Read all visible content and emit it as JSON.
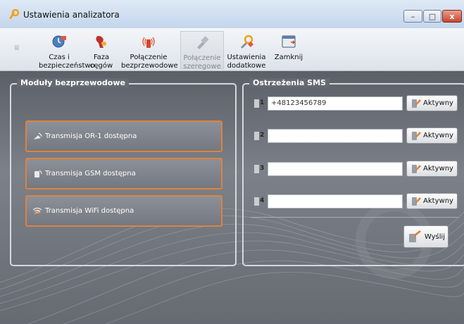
{
  "window": {
    "title": "Ustawienia analizatora",
    "minimize": "–",
    "maximize": "□",
    "close": "x"
  },
  "toolbar": {
    "items": [
      {
        "label1": "Czas i",
        "label2": "bezpieczeństwo",
        "icon": "clock-security-icon"
      },
      {
        "label1": "Faza",
        "label2": "cęgów",
        "icon": "clamp-phase-icon"
      },
      {
        "label1": "Połączenie",
        "label2": "bezprzewodowe",
        "icon": "wireless-connection-icon"
      },
      {
        "label1": "Połączenie",
        "label2": "szeregowe",
        "icon": "serial-connection-icon"
      },
      {
        "label1": "Ustawienia",
        "label2": "dodatkowe",
        "icon": "additional-settings-icon"
      },
      {
        "label1": "Zamknij",
        "label2": "",
        "icon": "close-window-icon"
      }
    ]
  },
  "wireless": {
    "title": "Moduły bezprzewodowe",
    "items": [
      {
        "label": "Transmisja OR-1 dostępna"
      },
      {
        "label": "Transmisja GSM dostępna"
      },
      {
        "label": "Transmisja WiFi dostępna"
      }
    ]
  },
  "sms": {
    "title": "Ostrzeżenia SMS",
    "rows": [
      {
        "index": "1",
        "value": "+48123456789",
        "button": "Aktywny"
      },
      {
        "index": "2",
        "value": "",
        "button": "Aktywny"
      },
      {
        "index": "3",
        "value": "",
        "button": "Aktywny"
      },
      {
        "index": "4",
        "value": "",
        "button": "Aktywny"
      }
    ],
    "send_label": "Wyślij"
  },
  "colors": {
    "accent": "#e0823b",
    "panel": "#6b7078"
  }
}
